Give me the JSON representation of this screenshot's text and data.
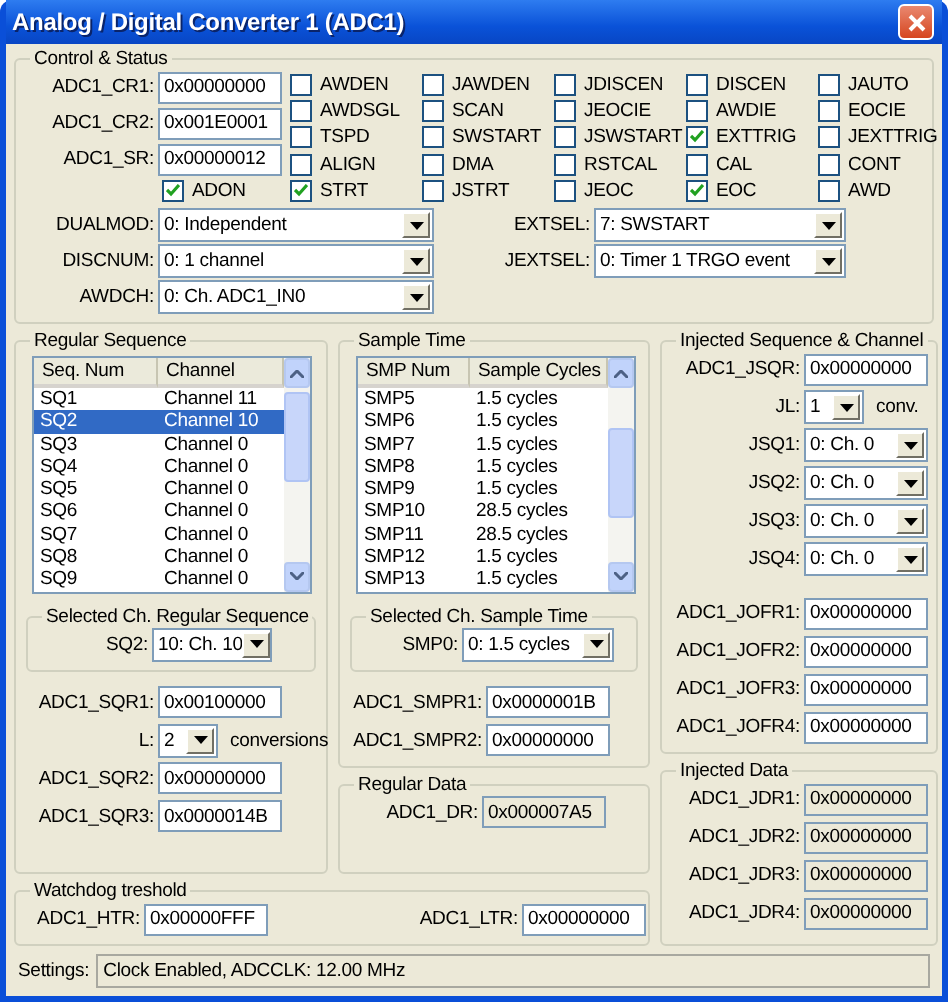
{
  "window": {
    "title": "Analog / Digital Converter 1 (ADC1)"
  },
  "control_status": {
    "title": "Control & Status",
    "registers": [
      {
        "label": "ADC1_CR1:",
        "value": "0x00000000"
      },
      {
        "label": "ADC1_CR2:",
        "value": "0x001E0001"
      },
      {
        "label": "ADC1_SR:",
        "value": "0x00000012"
      }
    ],
    "adon": {
      "label": "ADON",
      "checked": true
    },
    "flags": [
      {
        "label": "AWDEN",
        "checked": false
      },
      {
        "label": "JAWDEN",
        "checked": false
      },
      {
        "label": "JDISCEN",
        "checked": false
      },
      {
        "label": "DISCEN",
        "checked": false
      },
      {
        "label": "JAUTO",
        "checked": false
      },
      {
        "label": "AWDSGL",
        "checked": false
      },
      {
        "label": "SCAN",
        "checked": false
      },
      {
        "label": "JEOCIE",
        "checked": false
      },
      {
        "label": "AWDIE",
        "checked": false
      },
      {
        "label": "EOCIE",
        "checked": false
      },
      {
        "label": "TSPD",
        "checked": false
      },
      {
        "label": "SWSTART",
        "checked": false
      },
      {
        "label": "JSWSTART",
        "checked": false
      },
      {
        "label": "EXTTRIG",
        "checked": true
      },
      {
        "label": "JEXTTRIG",
        "checked": false
      },
      {
        "label": "ALIGN",
        "checked": false
      },
      {
        "label": "DMA",
        "checked": false
      },
      {
        "label": "RSTCAL",
        "checked": false
      },
      {
        "label": "CAL",
        "checked": false
      },
      {
        "label": "CONT",
        "checked": false
      },
      {
        "label": "STRT",
        "checked": true
      },
      {
        "label": "JSTRT",
        "checked": false
      },
      {
        "label": "JEOC",
        "checked": false
      },
      {
        "label": "EOC",
        "checked": true
      },
      {
        "label": "AWD",
        "checked": false
      }
    ],
    "left_selects": [
      {
        "label": "DUALMOD:",
        "value": "0: Independent"
      },
      {
        "label": "DISCNUM:",
        "value": "0: 1 channel"
      },
      {
        "label": "AWDCH:",
        "value": "0:  Ch. ADC1_IN0"
      }
    ],
    "right_selects": [
      {
        "label": "EXTSEL:",
        "value": "7: SWSTART"
      },
      {
        "label": "JEXTSEL:",
        "value": "0: Timer 1 TRGO event"
      }
    ]
  },
  "regular_sequence": {
    "title": "Regular Sequence",
    "columns": [
      "Seq. Num",
      "Channel"
    ],
    "rows": [
      {
        "cells": [
          "SQ1",
          "Channel 11"
        ],
        "selected": false
      },
      {
        "cells": [
          "SQ2",
          "Channel 10"
        ],
        "selected": true
      },
      {
        "cells": [
          "SQ3",
          "Channel 0"
        ],
        "selected": false
      },
      {
        "cells": [
          "SQ4",
          "Channel 0"
        ],
        "selected": false
      },
      {
        "cells": [
          "SQ5",
          "Channel 0"
        ],
        "selected": false
      },
      {
        "cells": [
          "SQ6",
          "Channel 0"
        ],
        "selected": false
      },
      {
        "cells": [
          "SQ7",
          "Channel 0"
        ],
        "selected": false
      },
      {
        "cells": [
          "SQ8",
          "Channel 0"
        ],
        "selected": false
      },
      {
        "cells": [
          "SQ9",
          "Channel 0"
        ],
        "selected": false
      }
    ],
    "selected_group": {
      "title": "Selected Ch. Regular Sequence",
      "label": "SQ2:",
      "value": "10: Ch. 10"
    },
    "sqr1": {
      "label": "ADC1_SQR1:",
      "value": "0x00100000"
    },
    "length": {
      "label": "L:",
      "value": "2",
      "unit": "conversions"
    },
    "registers": [
      {
        "label": "ADC1_SQR2:",
        "value": "0x00000000"
      },
      {
        "label": "ADC1_SQR3:",
        "value": "0x0000014B"
      }
    ]
  },
  "sample_time": {
    "title": "Sample Time",
    "columns": [
      "SMP Num",
      "Sample Cycles"
    ],
    "rows": [
      {
        "cells": [
          "SMP5",
          "1.5 cycles"
        ]
      },
      {
        "cells": [
          "SMP6",
          "1.5 cycles"
        ]
      },
      {
        "cells": [
          "SMP7",
          "1.5 cycles"
        ]
      },
      {
        "cells": [
          "SMP8",
          "1.5 cycles"
        ]
      },
      {
        "cells": [
          "SMP9",
          "1.5 cycles"
        ]
      },
      {
        "cells": [
          "SMP10",
          "28.5 cycles"
        ]
      },
      {
        "cells": [
          "SMP11",
          "28.5 cycles"
        ]
      },
      {
        "cells": [
          "SMP12",
          "1.5 cycles"
        ]
      },
      {
        "cells": [
          "SMP13",
          "1.5 cycles"
        ]
      }
    ],
    "selected_group": {
      "title": "Selected Ch. Sample Time",
      "label": "SMP0:",
      "value": "0: 1.5 cycles"
    },
    "registers": [
      {
        "label": "ADC1_SMPR1:",
        "value": "0x0000001B"
      },
      {
        "label": "ADC1_SMPR2:",
        "value": "0x00000000"
      }
    ]
  },
  "regular_data": {
    "title": "Regular Data",
    "registers": [
      {
        "label": "ADC1_DR:",
        "value": "0x000007A5",
        "readonly": true
      }
    ]
  },
  "injected_sequence": {
    "title": "Injected Sequence & Channel",
    "jsqr": {
      "label": "ADC1_JSQR:",
      "value": "0x00000000"
    },
    "length": {
      "label": "JL:",
      "value": "1",
      "unit": "conv."
    },
    "selects": [
      {
        "label": "JSQ1:",
        "value": "0: Ch. 0"
      },
      {
        "label": "JSQ2:",
        "value": "0: Ch. 0"
      },
      {
        "label": "JSQ3:",
        "value": "0: Ch. 0"
      },
      {
        "label": "JSQ4:",
        "value": "0: Ch. 0"
      }
    ],
    "registers": [
      {
        "label": "ADC1_JOFR1:",
        "value": "0x00000000"
      },
      {
        "label": "ADC1_JOFR2:",
        "value": "0x00000000"
      },
      {
        "label": "ADC1_JOFR3:",
        "value": "0x00000000"
      },
      {
        "label": "ADC1_JOFR4:",
        "value": "0x00000000"
      }
    ]
  },
  "injected_data": {
    "title": "Injected Data",
    "registers": [
      {
        "label": "ADC1_JDR1:",
        "value": "0x00000000",
        "readonly": true
      },
      {
        "label": "ADC1_JDR2:",
        "value": "0x00000000",
        "readonly": true
      },
      {
        "label": "ADC1_JDR3:",
        "value": "0x00000000",
        "readonly": true
      },
      {
        "label": "ADC1_JDR4:",
        "value": "0x00000000",
        "readonly": true
      }
    ]
  },
  "watchdog": {
    "title": "Watchdog treshold",
    "registers": [
      {
        "label": "ADC1_HTR:",
        "value": "0x00000FFF"
      },
      {
        "label": "ADC1_LTR:",
        "value": "0x00000000"
      }
    ]
  },
  "status_bar": {
    "label": "Settings:",
    "value": "Clock Enabled, ADCCLK: 12.00 MHz"
  }
}
